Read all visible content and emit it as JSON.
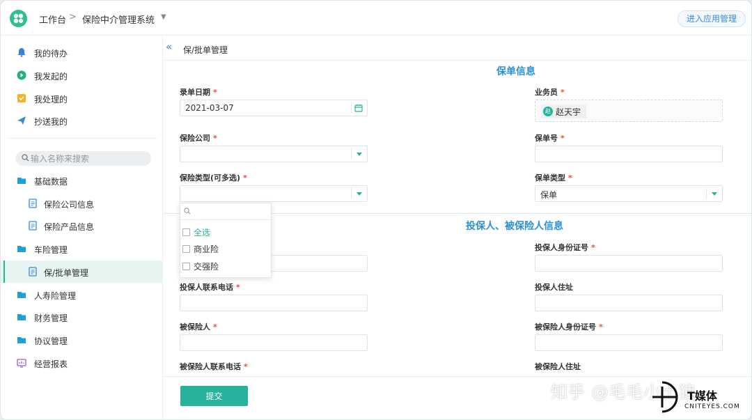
{
  "topbar": {
    "crumb_home": "工作台",
    "crumb_separator": ">",
    "app_name": "保险中介管理系统",
    "enter_app_label": "进入应用管理"
  },
  "sidebar": {
    "top_items": [
      {
        "label": "我的待办",
        "icon": "bell-icon"
      },
      {
        "label": "我发起的",
        "icon": "play-icon"
      },
      {
        "label": "我处理的",
        "icon": "checklist-icon"
      },
      {
        "label": "抄送我的",
        "icon": "send-icon"
      }
    ],
    "search_placeholder": "输入名称来搜索",
    "tree": [
      {
        "label": "基础数据",
        "icon": "folder-icon",
        "level": 0
      },
      {
        "label": "保险公司信息",
        "icon": "document-icon",
        "level": 1
      },
      {
        "label": "保险产品信息",
        "icon": "document-icon",
        "level": 1
      },
      {
        "label": "车险管理",
        "icon": "folder-icon",
        "level": 0
      },
      {
        "label": "保/批单管理",
        "icon": "document-icon",
        "level": 1,
        "active": true
      },
      {
        "label": "人寿险管理",
        "icon": "folder-icon",
        "level": 0
      },
      {
        "label": "财务管理",
        "icon": "folder-icon",
        "level": 0
      },
      {
        "label": "协议管理",
        "icon": "folder-icon",
        "level": 0
      },
      {
        "label": "经营报表",
        "icon": "report-icon",
        "level": 0
      }
    ]
  },
  "page": {
    "title": "保/批单管理",
    "collapse_icon": "double-chevron-left-icon"
  },
  "policy_section": {
    "title": "保单信息",
    "entry_date_label": "录单日期",
    "entry_date_value": "2021-03-07",
    "salesman_label": "业务员",
    "salesman_avatar": "赵",
    "salesman_name": "赵天宇",
    "insurer_label": "保险公司",
    "insurer_value": "",
    "policy_no_label": "保单号",
    "policy_no_value": "",
    "insurance_type_label": "保险类型(可多选)",
    "insurance_type_value": "",
    "policy_type_label": "保单类型",
    "policy_type_value": "保单"
  },
  "insurance_type_dropdown": {
    "search_placeholder": "",
    "options": [
      {
        "label": "全选",
        "checked": false
      },
      {
        "label": "商业险",
        "checked": false
      },
      {
        "label": "交强险",
        "checked": false
      }
    ]
  },
  "party_section": {
    "title": "投保人、被保险人信息",
    "holder_id_label": "投保人身份证号",
    "holder_phone_label": "投保人联系电话",
    "holder_address_label": "投保人住址",
    "insured_label": "被保险人",
    "insured_id_label": "被保险人身份证号",
    "insured_phone_label": "被保险人联系电话",
    "insured_address_label": "被保险人住址"
  },
  "footer": {
    "submit_label": "提交"
  },
  "watermark": {
    "zhihu": "知乎 @毛毛小土狼",
    "brand": "T媒体",
    "site": "CNITEYES.COM"
  },
  "colors": {
    "accent": "#26b29b",
    "section_title": "#2a8fd6",
    "required": "#e84c3d"
  }
}
